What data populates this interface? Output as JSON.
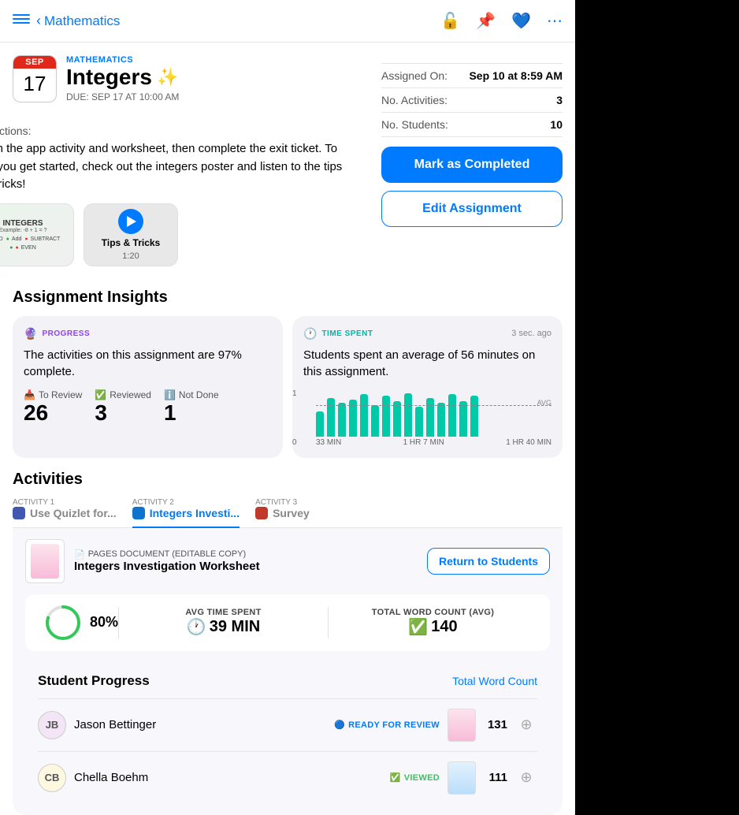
{
  "nav": {
    "back_label": "Mathematics",
    "sidebar_label": "Sidebar",
    "icons": [
      "unlock",
      "pin",
      "heart",
      "more"
    ]
  },
  "assignment": {
    "date_month": "SEP",
    "date_day": "17",
    "subject": "MATHEMATICS",
    "title": "Integers",
    "sparkle": "✨",
    "due": "DUE: SEP 17 AT 10:00 AM",
    "assigned_on_label": "Assigned On:",
    "assigned_on_value": "Sep 10 at 8:59 AM",
    "activities_label": "No. Activities:",
    "activities_value": "3",
    "students_label": "No. Students:",
    "students_value": "10",
    "mark_completed": "Mark as Completed",
    "edit_assignment": "Edit Assignment"
  },
  "instructions": {
    "label": "Instructions:",
    "text": "Finish the app activity and worksheet, then complete the exit ticket. To help you get started, check out the integers poster and listen to the tips and tricks!"
  },
  "attachments": {
    "poster_title": "INTEGERS",
    "video_title": "Tips & Tricks",
    "video_duration": "1:20"
  },
  "insights": {
    "section_title": "Assignment Insights",
    "progress": {
      "badge": "PROGRESS",
      "icon": "circle-progress",
      "text": "The activities on this assignment are 97% complete.",
      "to_review_label": "To Review",
      "to_review_value": "26",
      "reviewed_label": "Reviewed",
      "reviewed_value": "3",
      "not_done_label": "Not Done",
      "not_done_value": "1"
    },
    "time_spent": {
      "badge": "TIME SPENT",
      "icon": "clock",
      "time_ago": "3 sec. ago",
      "text": "Students spent an average of 56 minutes on this assignment.",
      "chart_axis_top": "1",
      "chart_axis_bottom": "0",
      "chart_labels": [
        "33 MIN",
        "1 HR 7 MIN",
        "1 HR 40 MIN"
      ],
      "avg_label": "AVG",
      "bars": [
        35,
        55,
        48,
        52,
        60,
        45,
        58,
        50,
        62,
        42,
        55,
        48,
        60,
        50,
        58
      ]
    }
  },
  "activities": {
    "section_title": "Activities",
    "tabs": [
      {
        "label": "ACTIVITY 1",
        "name": "Use Quizlet for...",
        "icon": "quizlet"
      },
      {
        "label": "ACTIVITY 2",
        "name": "Integers Investi...",
        "icon": "pages",
        "active": true
      },
      {
        "label": "ACTIVITY 3",
        "name": "Survey",
        "icon": "survey"
      }
    ],
    "active_doc": {
      "type": "PAGES DOCUMENT (EDITABLE COPY)",
      "name": "Integers Investigation Worksheet",
      "return_btn": "Return to Students"
    },
    "metrics": {
      "progress_pct": 80,
      "avg_time_label": "AVG TIME SPENT",
      "avg_time_value": "39 MIN",
      "word_count_label": "TOTAL WORD COUNT (AVG)",
      "word_count_value": "140"
    }
  },
  "student_progress": {
    "title": "Student Progress",
    "sort_link": "Total Word Count",
    "students": [
      {
        "initials": "JB",
        "name": "Jason Bettinger",
        "status": "READY FOR REVIEW",
        "status_type": "review",
        "word_count": "131"
      },
      {
        "initials": "CB",
        "name": "Chella Boehm",
        "status": "VIEWED",
        "status_type": "viewed",
        "word_count": "111"
      }
    ]
  }
}
